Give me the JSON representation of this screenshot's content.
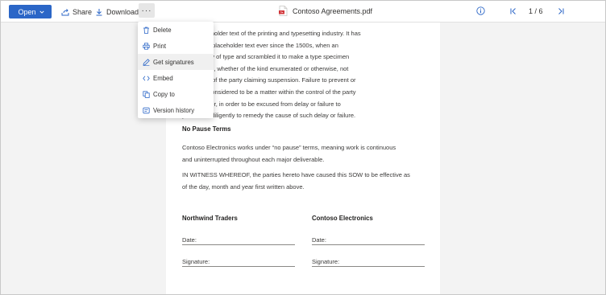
{
  "toolbar": {
    "open_label": "Open",
    "share_label": "Share",
    "download_label": "Download",
    "more_label": "···",
    "document_title": "Contoso Agreements.pdf",
    "page_indicator": "1 / 6"
  },
  "menu": {
    "items": [
      {
        "label": "Delete",
        "icon": "trash-icon"
      },
      {
        "label": "Print",
        "icon": "printer-icon"
      },
      {
        "label": "Get signatures",
        "icon": "pen-icon"
      },
      {
        "label": "Embed",
        "icon": "code-icon"
      },
      {
        "label": "Copy to",
        "icon": "copy-icon"
      },
      {
        "label": "Version history",
        "icon": "history-icon"
      }
    ],
    "highlighted": "Get signatures"
  },
  "document": {
    "para1_lines": [
      "mply placeholder text of the printing and typesetting industry. It has",
      "s standard placeholder text ever since the 1500s, when an",
      "ook a galley of type and scrambled it to make a type specimen",
      "other cause, whether of the kind enumerated or otherwise, not",
      "the control of the party claiming suspension. Failure to prevent or",
      "all not be considered to be a matter within the control of the party",
      "on. However, in order to be excused from delay or failure to",
      "y must act diligently to remedy the cause of such delay or failure."
    ],
    "heading_no_pause": "No Pause Terms",
    "para2_lines": [
      "Contoso Electronics works under “no pause” terms, meaning work is continuous",
      "and uninterrupted throughout each major deliverable."
    ],
    "para3_lines": [
      "IN WITNESS WHEREOF, the parties hereto have caused this SOW to be effective as",
      "of the day, month and year first written above."
    ],
    "signatories": {
      "left_party": "Northwind Traders",
      "right_party": "Contoso Electronics",
      "date_label": "Date:",
      "signature_label": "Signature:"
    }
  },
  "colors": {
    "accent": "#2b66c7",
    "pdf_icon": "#d13438",
    "background": "#f3f3f3"
  }
}
